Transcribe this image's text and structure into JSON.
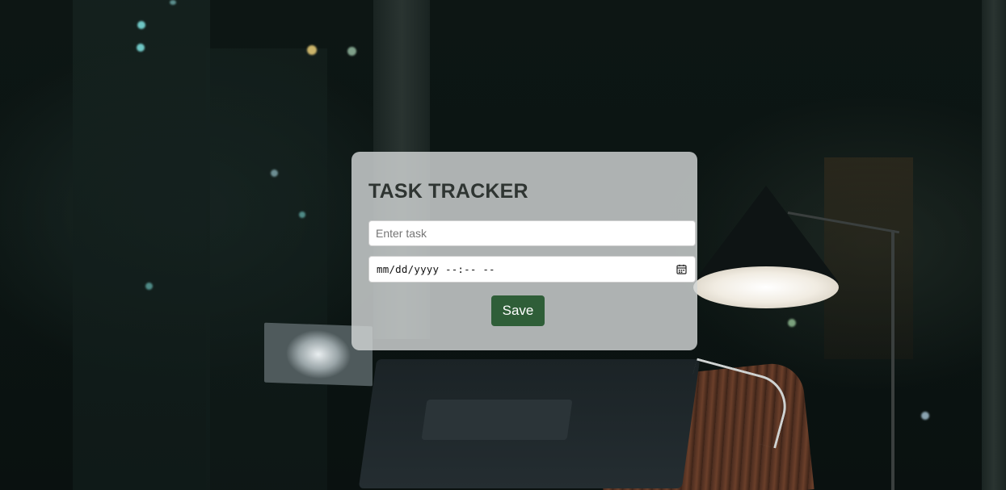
{
  "app": {
    "title": "TASK TRACKER"
  },
  "form": {
    "task_placeholder": "Enter task",
    "task_value": "",
    "datetime_display": "mm/dd/yyyy --:-- --",
    "save_label": "Save"
  },
  "icons": {
    "calendar": "calendar-icon"
  },
  "colors": {
    "card_bg": "#d2d6d6",
    "title": "#2f3532",
    "save_button": "#2f5e38",
    "save_text": "#ffffff"
  }
}
